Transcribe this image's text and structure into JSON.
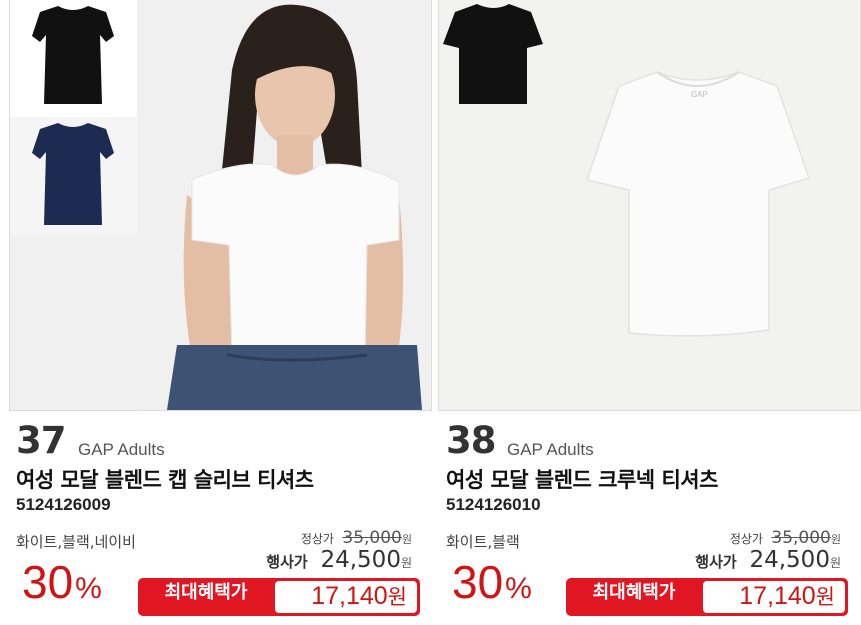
{
  "products": [
    {
      "rank": "37",
      "brand": "GAP Adults",
      "name": "여성 모달 블렌드 캡 슬리브 티셔츠",
      "code": "5124126009",
      "colors": "화이트,블랙,네이비",
      "discount_value": "30",
      "discount_unit": "%",
      "regular_label": "정상가",
      "regular_price": "35,000",
      "regular_unit": "원",
      "sale_label": "행사가",
      "sale_price": "24,500",
      "sale_unit": "원",
      "benefit_label": "최대혜택가",
      "benefit_price": "17,140",
      "benefit_unit": "원"
    },
    {
      "rank": "38",
      "brand": "GAP Adults",
      "name": "여성 모달 블렌드 크루넥 티셔츠",
      "code": "5124126010",
      "colors": "화이트,블랙",
      "discount_value": "30",
      "discount_unit": "%",
      "regular_label": "정상가",
      "regular_price": "35,000",
      "regular_unit": "원",
      "sale_label": "행사가",
      "sale_price": "24,500",
      "sale_unit": "원",
      "benefit_label": "최대혜택가",
      "benefit_price": "17,140",
      "benefit_unit": "원"
    }
  ],
  "tshirt_logo": "GAP",
  "colors": {
    "accent_red": "#e01623",
    "discount_red": "#d01414",
    "swatch_black": "#111111",
    "swatch_navy": "#1d2a52",
    "shirt_white": "#fbfbfb"
  }
}
